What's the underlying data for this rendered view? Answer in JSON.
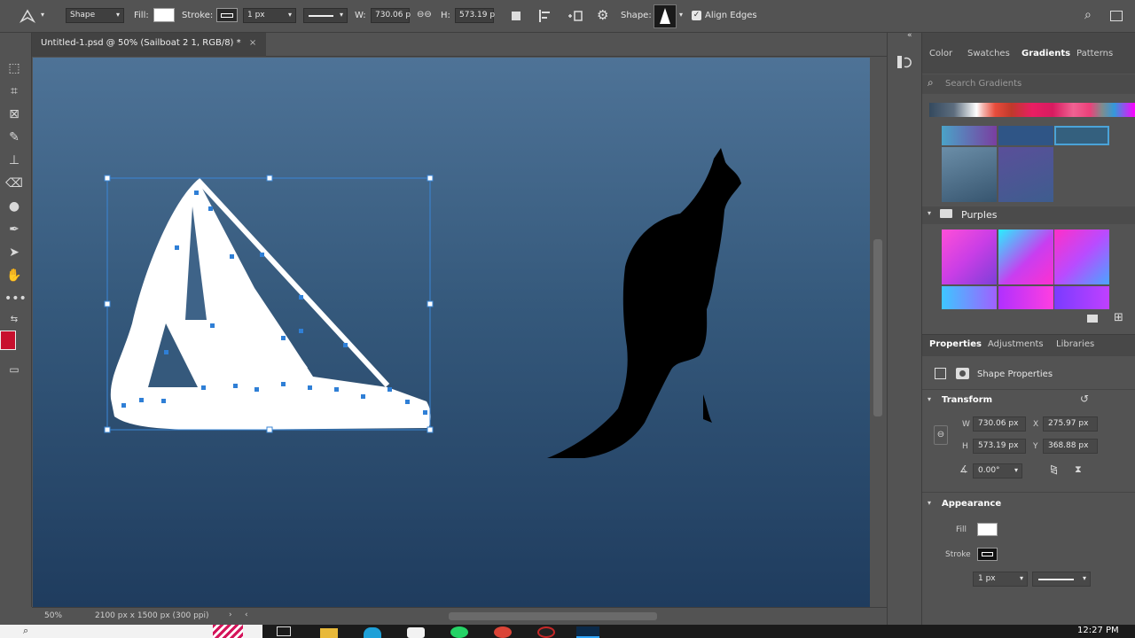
{
  "options_bar": {
    "mode": "Shape",
    "fill_label": "Fill:",
    "stroke_label": "Stroke:",
    "stroke_width": "1 px",
    "w_label": "W:",
    "w_value": "730.06 p",
    "h_label": "H:",
    "h_value": "573.19 p",
    "shape_label": "Shape:",
    "align_edges": "Align Edges",
    "fill_color": "#ffffff",
    "stroke_color": "#000000"
  },
  "document": {
    "tab_title": "Untitled-1.psd @ 50% (Sailboat 2 1, RGB/8) *",
    "zoom": "50%",
    "doc_info": "2100 px x 1500 px (300 ppi)"
  },
  "colors": {
    "foreground": "#c8102e",
    "accent": "#1473e6"
  },
  "panel_tabs": [
    "Color",
    "Swatches",
    "Gradients",
    "Patterns"
  ],
  "gradients": {
    "search_placeholder": "Search Gradients",
    "group_name": "Purples"
  },
  "properties_tabs": [
    "Properties",
    "Adjustments",
    "Libraries"
  ],
  "properties": {
    "shape_properties": "Shape Properties",
    "transform_title": "Transform",
    "w_label": "W",
    "w_value": "730.06 px",
    "x_label": "X",
    "x_value": "275.97 px",
    "h_label": "H",
    "h_value": "573.19 px",
    "y_label": "Y",
    "y_value": "368.88 px",
    "angle": "0.00°",
    "appearance_title": "Appearance",
    "fill_label": "Fill",
    "stroke_label": "Stroke",
    "stroke_width": "1 px"
  },
  "taskbar": {
    "time": "12:27 PM"
  }
}
